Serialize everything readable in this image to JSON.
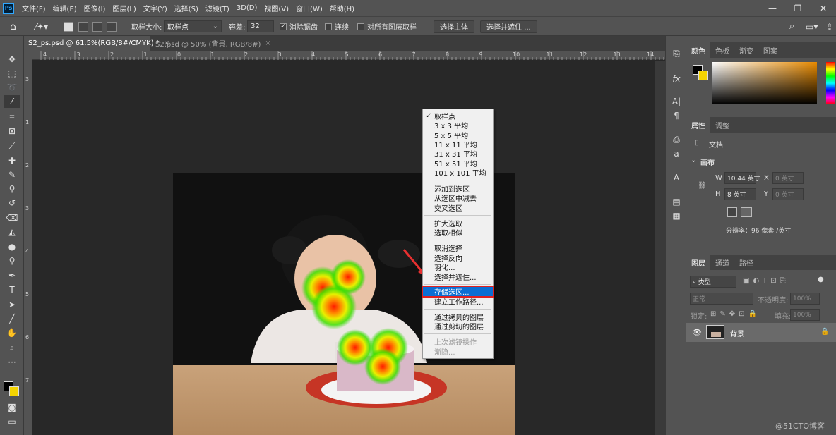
{
  "menu": [
    "文件(F)",
    "编辑(E)",
    "图像(I)",
    "图层(L)",
    "文字(Y)",
    "选择(S)",
    "滤镜(T)",
    "3D(D)",
    "视图(V)",
    "窗口(W)",
    "帮助(H)"
  ],
  "app_logo": "Ps",
  "options": {
    "sample_size_label": "取样大小:",
    "sample_size_value": "取样点",
    "tolerance_label": "容差:",
    "tolerance_value": "32",
    "anti_alias": "消除锯齿",
    "contiguous": "连续",
    "all_layers": "对所有图层取样",
    "select_subject": "选择主体",
    "select_and_mask": "选择并遮住 ..."
  },
  "tabs": [
    {
      "label": "S2_ps.psd @ 61.5%(RGB/8#/CMYK) *",
      "active": true
    },
    {
      "label": "S2.psd @ 50% (背景, RGB/8#)",
      "active": false
    }
  ],
  "ruler_top": [
    "4",
    "3",
    "2",
    "1",
    "0",
    "1",
    "2",
    "3",
    "4",
    "5",
    "6",
    "7",
    "8",
    "9",
    "10",
    "11",
    "12",
    "13",
    "14"
  ],
  "ruler_left": [
    "3",
    "1",
    "2",
    "3",
    "4",
    "5",
    "6",
    "7"
  ],
  "context_menu": {
    "group1": [
      "取样点",
      "3 x 3 平均",
      "5 x 5 平均",
      "11 x 11 平均",
      "31 x 31 平均",
      "51 x 51 平均",
      "101 x 101 平均"
    ],
    "group2": [
      "添加到选区",
      "从选区中减去",
      "交叉选区"
    ],
    "group3": [
      "扩大选取",
      "选取相似"
    ],
    "group4": [
      "取消选择",
      "选择反向",
      "羽化...",
      "选择并遮住..."
    ],
    "group5": [
      "存储选区...",
      "建立工作路径..."
    ],
    "group6": [
      "通过拷贝的图层",
      "通过剪切的图层"
    ],
    "group7": [
      "上次滤镜操作",
      "渐隐..."
    ]
  },
  "color_panel": {
    "tabs": [
      "颜色",
      "色板",
      "渐变",
      "图案"
    ]
  },
  "props_panel": {
    "tabs": [
      "属性",
      "调整"
    ],
    "doc_label": "文档",
    "canvas_label": "画布",
    "w_label": "W",
    "w_value": "10.44 英寸",
    "x_label": "X",
    "x_value": "0 英寸",
    "h_label": "H",
    "h_value": "8 英寸",
    "y_label": "Y",
    "y_value": "0 英寸",
    "resolution": "分辨率：96 像素 /英寸"
  },
  "layers_panel": {
    "tabs": [
      "图层",
      "通道",
      "路径"
    ],
    "filter_label": "类型",
    "blend_mode": "正常",
    "opacity_label": "不透明度:",
    "opacity_value": "100%",
    "lock_label": "锁定:",
    "fill_label": "填充:",
    "fill_value": "100%",
    "layer_name": "背景"
  },
  "watermark": "@51CTO博客",
  "colors": {
    "accent": "#0b6ed3",
    "highlight_border": "#e02020",
    "arrow": "#e83030"
  }
}
